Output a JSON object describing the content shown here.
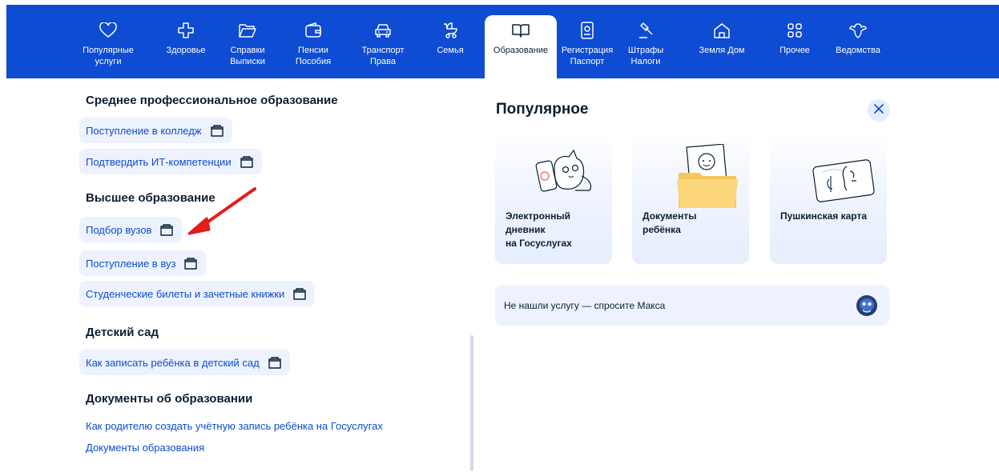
{
  "nav": {
    "items": [
      {
        "label": "Популярные\nуслуги",
        "icon": "heart-icon"
      },
      {
        "label": "Здоровье",
        "icon": "medical-cross-icon"
      },
      {
        "label": "Справки\nВыписки",
        "icon": "folder-icon"
      },
      {
        "label": "Пенсии\nПособия",
        "icon": "wallet-icon"
      },
      {
        "label": "Транспорт\nПрава",
        "icon": "car-icon"
      },
      {
        "label": "Семья",
        "icon": "stroller-icon"
      },
      {
        "label": "Образование",
        "icon": "book-icon"
      },
      {
        "label": "Регистрация\nПаспорт",
        "icon": "passport-icon"
      },
      {
        "label": "Штрафы\nНалоги",
        "icon": "gavel-icon"
      },
      {
        "label": "Земля Дом",
        "icon": "house-icon"
      },
      {
        "label": "Прочее",
        "icon": "grid-icon"
      },
      {
        "label": "Ведомства",
        "icon": "emblem-icon"
      }
    ],
    "active": "Образование",
    "colors": {
      "bar": "#0d4cd3",
      "text": "#ffffff"
    }
  },
  "left": {
    "cut_heading": "Среднее профессиональное образование",
    "spo_links": [
      "Поступление в колледж",
      "Подтвердить ИТ-компетенции"
    ],
    "higher": {
      "heading": "Высшее образование",
      "links": [
        "Подбор вузов",
        "Поступление в вуз",
        "Студенческие билеты и зачетные книжки"
      ]
    },
    "kindergarten": {
      "heading": "Детский сад",
      "links": [
        "Как записать ребёнка в детский сад"
      ]
    },
    "docs": {
      "heading": "Документы об образовании",
      "links": [
        "Как родителю создать учётную запись ребёнка на Госуслугах",
        "Документы образования"
      ]
    }
  },
  "right": {
    "title": "Популярное",
    "cards": [
      {
        "text": "Электронный\nдневник\nна Госуслугах",
        "icon": "cat-phone-illustration"
      },
      {
        "text": "Документы\nребёнка",
        "icon": "child-folder-illustration"
      },
      {
        "text": "Пушкинская карта",
        "icon": "pushkin-card-illustration"
      }
    ],
    "ask": "Не нашли услугу — спросите Макса"
  },
  "colors": {
    "link": "#0d4cd3",
    "chip_bg": "#edf2fe",
    "annotation_arrow": "#e31b1b"
  }
}
